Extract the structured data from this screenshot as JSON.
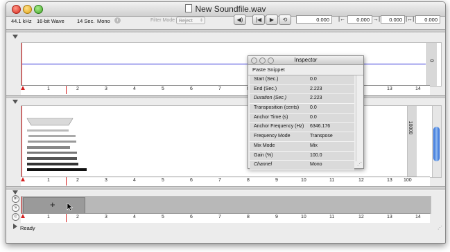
{
  "window": {
    "title": "New Soundfile.wav"
  },
  "toolbar": {
    "sample_rate": "44.1 kHz",
    "bit_depth": "16-bit Wave",
    "duration": "14 Sec.",
    "channels": "Mono",
    "filter_mode_label": "Filter Mode",
    "filter_mode_value": "Reject",
    "time_field": "0.000",
    "start_field": "0.000",
    "end_field": "0.000",
    "length_field": "0.000"
  },
  "ruler": {
    "ticks": [
      "1",
      "2",
      "3",
      "4",
      "5",
      "6",
      "7",
      "8",
      "9",
      "10",
      "11",
      "12",
      "13",
      "14"
    ]
  },
  "waveform": {
    "vertical_label": "0",
    "line_color": "#2a2ad6"
  },
  "spectrum": {
    "vertical_label": "10000",
    "corner_label": "100"
  },
  "inspector": {
    "title": "Inspector",
    "toolbar_label": "Paste Snippet",
    "rows": [
      {
        "key": "Start (Sec.)",
        "value": "0.0",
        "italic": false
      },
      {
        "key": "End (Sec.)",
        "value": "2.223",
        "italic": false
      },
      {
        "key": "Duration (Sec.)",
        "value": "2.223",
        "italic": true
      },
      {
        "key": "Transposition (cents)",
        "value": "0.0",
        "italic": false
      },
      {
        "key": "Anchor Time (s)",
        "value": "0.0",
        "italic": false
      },
      {
        "key": "Anchor Frequency (Hz)",
        "value": "6346.176",
        "italic": false
      },
      {
        "key": "Frequency Mode",
        "value": "Transpose",
        "italic": false
      },
      {
        "key": "Mix Mode",
        "value": "Mix",
        "italic": false
      },
      {
        "key": "Gain (%)",
        "value": "100.0",
        "italic": false
      },
      {
        "key": "Channel",
        "value": "Mono",
        "italic": true
      }
    ]
  },
  "status": {
    "text": "Ready"
  },
  "colors": {
    "playhead": "#d42020",
    "accent": "#2a6ad6"
  }
}
